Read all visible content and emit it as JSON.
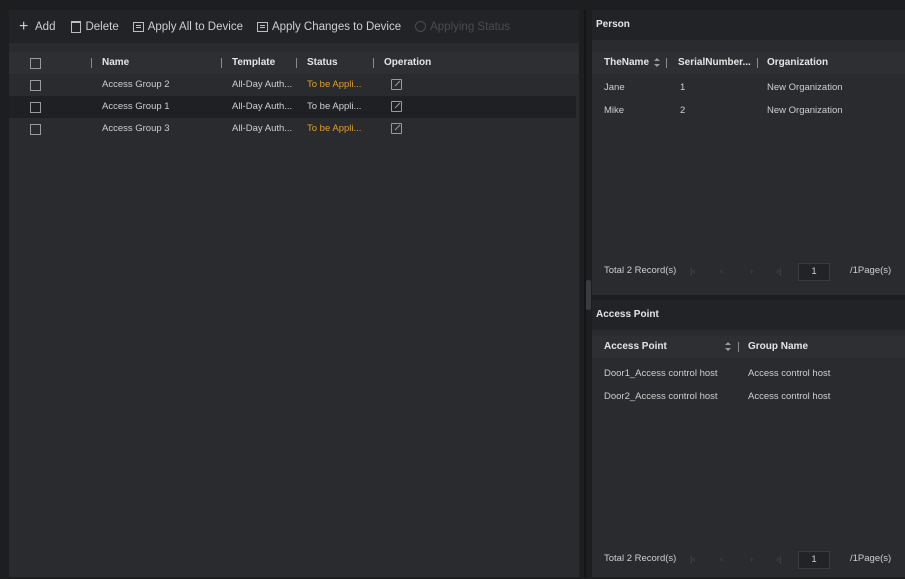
{
  "toolbar": {
    "add": "Add",
    "delete": "Delete",
    "apply_all": "Apply All to Device",
    "apply_changes": "Apply Changes to Device",
    "applying_status": "Applying Status"
  },
  "groups_table": {
    "headers": {
      "name": "Name",
      "template": "Template",
      "status": "Status",
      "operation": "Operation"
    },
    "rows": [
      {
        "name": "Access Group 2",
        "template": "All-Day Auth...",
        "status": "To be Appli...",
        "status_color": "#e09f2c"
      },
      {
        "name": "Access Group 1",
        "template": "All-Day Auth...",
        "status": "To be Appli...",
        "status_color": "#cfcfcf"
      },
      {
        "name": "Access Group 3",
        "template": "All-Day Auth...",
        "status": "To be Appli...",
        "status_color": "#e09f2c"
      }
    ]
  },
  "person_panel": {
    "title": "Person",
    "headers": {
      "name": "TheName",
      "serial": "SerialNumber...",
      "org": "Organization"
    },
    "rows": [
      {
        "name": "Jane",
        "serial": "1",
        "org": "New Organization"
      },
      {
        "name": "Mike",
        "serial": "2",
        "org": "New Organization"
      }
    ],
    "footer": {
      "total": "Total 2 Record(s)",
      "page": "1",
      "pages": "/1Page(s)"
    }
  },
  "access_point_panel": {
    "title": "Access Point",
    "headers": {
      "access_point": "Access Point",
      "group": "Group Name"
    },
    "rows": [
      {
        "access_point": "Door1_Access control host",
        "group": "Access control host"
      },
      {
        "access_point": "Door2_Access control host",
        "group": "Access control host"
      }
    ],
    "footer": {
      "total": "Total 2 Record(s)",
      "page": "1",
      "pages": "/1Page(s)"
    }
  },
  "colors": {
    "accent_orange": "#e09f2c",
    "background": "#2a2b2e"
  },
  "icons": [
    "plus-icon",
    "trash-icon",
    "device-icon",
    "status-icon",
    "edit-icon",
    "sort-icon"
  ]
}
